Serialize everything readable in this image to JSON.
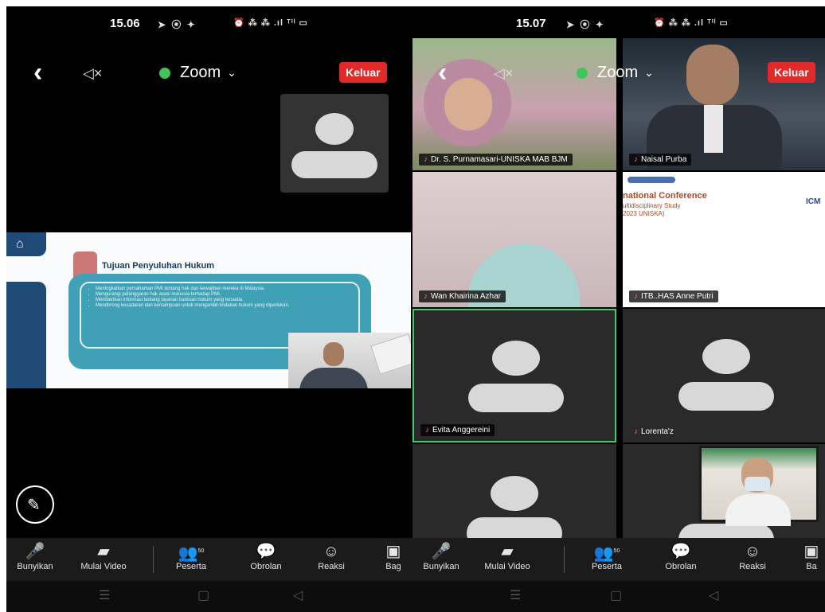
{
  "left_screen": {
    "status": {
      "time": "15.06",
      "indicators": "➤ ⦿ ✦",
      "system": "⏰ ⁂ ⁂ .ıl ᵀⁱˡ ▭"
    },
    "topbar": {
      "back": "‹",
      "speaker": "◁×",
      "meeting_name": "Zoom",
      "caret": "⌄",
      "leave": "Keluar"
    },
    "shared_slide": {
      "title": "Tujuan Penyuluhan Hukum",
      "bullets": [
        "Meningkatkan pemahaman PMI tentang hak dan kewajiban mereka di Malaysia.",
        "Mengurangi pelanggaran hak asasi manusia terhadap PMI.",
        "Memberikan informasi tentang layanan bantuan hukum yang tersedia.",
        "Mendorong kesadaran dan kemampuan untuk mengambil tindakan hukum yang diperlukan."
      ]
    },
    "toolbar": [
      {
        "icon": "🎤",
        "label": "Bunyikan"
      },
      {
        "icon": "▰",
        "label": "Mulai Video"
      },
      {
        "icon": "👥",
        "label": "Peserta",
        "badge": "50"
      },
      {
        "icon": "💬",
        "label": "Obrolan"
      },
      {
        "icon": "☺",
        "label": "Reaksi"
      },
      {
        "icon": "▣",
        "label": "Bag"
      }
    ]
  },
  "right_screen": {
    "status": {
      "time": "15.07",
      "indicators": "➤ ⦿ ✦",
      "system": "⏰ ⁂ ⁂ .ıl ᵀⁱˡ ▭"
    },
    "topbar": {
      "back": "‹",
      "speaker": "◁×",
      "meeting_name": "Zoom",
      "caret": "⌄",
      "leave": "Keluar"
    },
    "participants": [
      {
        "name": "Dr. S. Purnamasari-UNISKA MAB BJM"
      },
      {
        "name": "Naisal Purba"
      },
      {
        "name": "Wan Khairina Azhar"
      },
      {
        "name": "ITB..HAS Anne Putri",
        "slide_lines": [
          "national Conference",
          "ultidisciplinary Study",
          "2023 UNISKA)"
        ],
        "logo_text": "ICM"
      },
      {
        "name": "Evita Anggereini"
      },
      {
        "name": "Lorenta'z"
      },
      {
        "name": ""
      },
      {
        "name": ""
      }
    ],
    "toolbar": [
      {
        "icon": "🎤",
        "label": "Bunyikan"
      },
      {
        "icon": "▰",
        "label": "Mulai Video"
      },
      {
        "icon": "👥",
        "label": "Peserta",
        "badge": "50"
      },
      {
        "icon": "💬",
        "label": "Obrolan"
      },
      {
        "icon": "☺",
        "label": "Reaksi"
      },
      {
        "icon": "▣",
        "label": "Ba"
      }
    ]
  },
  "nav": {
    "menu": "☰",
    "home": "▢",
    "back": "◁"
  },
  "colors": {
    "leave": "#e02a2a",
    "active_speaker": "#3ad16b",
    "shield": "#3fc35a",
    "slide_card": "#3fa0b6"
  }
}
